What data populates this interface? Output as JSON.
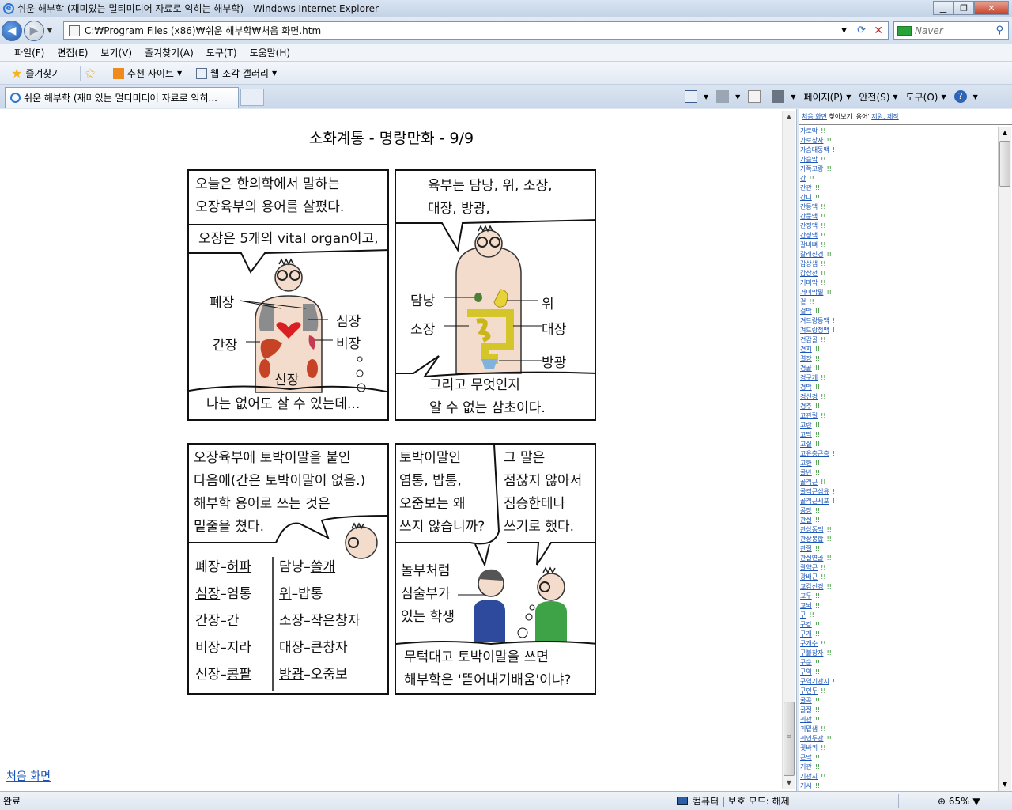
{
  "window": {
    "title": "쉬운 해부학 (재미있는 멀티미디어 자료로 익히는 해부학) - Windows Internet Explorer",
    "minimize": "▁",
    "maximize": "❐",
    "close": "✕"
  },
  "address": {
    "url": "C:₩Program Files (x86)₩쉬운 해부학₩처음 화면.htm",
    "search_placeholder": "Naver"
  },
  "menu": [
    "파일(F)",
    "편집(E)",
    "보기(V)",
    "즐겨찾기(A)",
    "도구(T)",
    "도움말(H)"
  ],
  "favorites": {
    "label": "즐겨찾기",
    "items": [
      "추천 사이트",
      "웹 조각 갤러리"
    ]
  },
  "tabs": [
    {
      "label": "쉬운 해부학 (재미있는 멀티미디어 자료로 익히..."
    }
  ],
  "commandbar": {
    "page": "페이지(P)",
    "safety": "안전(S)",
    "tools": "도구(O)"
  },
  "page": {
    "title": "소화계통 - 명랑만화 - 9/9",
    "home_link": "처음 화면"
  },
  "comic": {
    "p1": {
      "bubble_top": [
        "오늘은 한의학에서 말하는",
        "오장육부의 용어를 살폈다."
      ],
      "bubble_mid": "오장은 5개의 vital organ이고,",
      "labels": {
        "lung": "폐장",
        "heart": "심장",
        "liver": "간장",
        "spleen": "비장",
        "kidney": "신장"
      },
      "bubble_bottom": "나는 없어도 살 수 있는데..."
    },
    "p2": {
      "bubble_top": [
        "육부는 담낭, 위, 소장,",
        "대장, 방광,"
      ],
      "labels": {
        "gb": "담낭",
        "stomach": "위",
        "small": "소장",
        "large": "대장",
        "bladder": "방광"
      },
      "bubble_bottom": [
        "그리고 무엇인지",
        "알 수 없는 삼초이다."
      ]
    },
    "p3": {
      "bubble": [
        "오장육부에 토박이말을 붙인",
        "다음에(간은 토박이말이 없음.)",
        "해부학 용어로 쓰는 것은",
        "밑줄을 쳤다."
      ],
      "left": [
        {
          "a": "폐장",
          "b": "허파",
          "ua": false,
          "ub": true
        },
        {
          "a": "심장",
          "b": "염통",
          "ua": true,
          "ub": false
        },
        {
          "a": "간장",
          "b": "간",
          "ua": false,
          "ub": true
        },
        {
          "a": "비장",
          "b": "지라",
          "ua": false,
          "ub": true
        },
        {
          "a": "신장",
          "b": "콩팥",
          "ua": false,
          "ub": true
        }
      ],
      "right": [
        {
          "a": "담낭",
          "b": "쓸개",
          "ua": false,
          "ub": true
        },
        {
          "a": "위",
          "b": "밥통",
          "ua": true,
          "ub": false
        },
        {
          "a": "소장",
          "b": "작은창자",
          "ua": false,
          "ub": true
        },
        {
          "a": "대장",
          "b": "큰창자",
          "ua": false,
          "ub": true
        },
        {
          "a": "방광",
          "b": "오줌보",
          "ua": true,
          "ub": false
        }
      ]
    },
    "p4": {
      "bubble_left": [
        "토박이말인",
        "염통, 밥통,",
        "오줌보는 왜",
        "쓰지 않습니까?"
      ],
      "bubble_right": [
        "그 말은",
        "점잖지 않아서",
        "짐승한테나",
        "쓰기로 했다."
      ],
      "student_label": [
        "놀부처럼",
        "심술부가",
        "있는 학생"
      ],
      "bubble_bottom": [
        "무턱대고 토박이말을 쓰면",
        "해부학은 '뜯어내기배움'이냐?"
      ]
    }
  },
  "rightframe": {
    "top_text": "처음 화면 찾아보기 '용어' 지원, 제작",
    "top_link1": "처음 화면",
    "top_mid": "찾아보기 '용어'",
    "top_link2": "지원, 제작",
    "mark": "!!",
    "items": [
      "가로막",
      "가로창자",
      "가슴대동맥",
      "가슴막",
      "가쪽고랑",
      "간",
      "간관",
      "간니",
      "간동맥",
      "간문맥",
      "간정맥",
      "간정맥",
      "갈비뼈",
      "갈래신경",
      "갑상샘",
      "갑상선",
      "거미막",
      "거미막밑",
      "겉",
      "겉막",
      "겨드랑동맥",
      "겨드랑정맥",
      "견갑골",
      "견치",
      "결장",
      "경골",
      "경구개",
      "경막",
      "경신경",
      "경추",
      "고관절",
      "고랑",
      "고막",
      "고실",
      "고유층근층",
      "고환",
      "골반",
      "골격근",
      "골격근섬유",
      "골격근세포",
      "공장",
      "관절",
      "관상동맥",
      "관상봉합",
      "관절",
      "관절연골",
      "괄약근",
      "광배근",
      "교감신경",
      "교두",
      "교뇌",
      "구",
      "구강",
      "구개",
      "구개수",
      "구불창자",
      "구순",
      "구역",
      "구역기관지",
      "구인두",
      "굴곡",
      "굴절",
      "귀관",
      "귀밑샘",
      "귀인두관",
      "귓바퀴",
      "근막",
      "기관",
      "기관지",
      "기시"
    ]
  },
  "status": {
    "left": "완료",
    "zone": "컴퓨터 | 보호 모드: 해제",
    "zoom": "65%"
  }
}
